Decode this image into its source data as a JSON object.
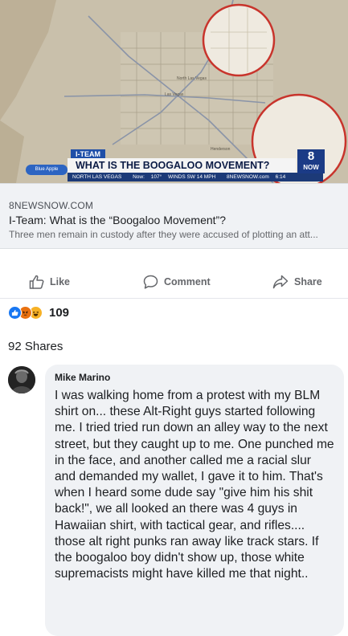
{
  "thumbnail": {
    "map_labels": [
      "North Las Vegas",
      "Las Vegas",
      "Henderson"
    ],
    "segment_tag": "I-TEAM",
    "headline": "WHAT IS THE BOOGALOO MOVEMENT?",
    "location": "NORTH LAS VEGAS",
    "weather_now": "Now:",
    "weather_temp": "107°",
    "wind": "WINDS SW 14 MPH",
    "site": "8NEWSNOW.com",
    "time": "6:14",
    "sponsor": "Blue Apple",
    "station_number": "8",
    "station_now": "NOW"
  },
  "preview": {
    "site": "8NEWSNOW.COM",
    "title": "I-Team: What is the “Boogaloo Movement”?",
    "description": "Three men remain in custody after they were accused of plotting an att..."
  },
  "actions": {
    "like": "Like",
    "comment": "Comment",
    "share": "Share"
  },
  "reactions": {
    "count": "109",
    "icons": [
      "like-icon",
      "angry-icon",
      "haha-icon"
    ]
  },
  "shares": "92 Shares",
  "comment": {
    "author": "Mike Marino",
    "text": "I was walking home from a protest with my BLM shirt on... these Alt-Right guys started following me. I tried tried run down an alley way to the next street, but they caught up to me. One punched me in the face, and another called me a racial slur and demanded my wallet, I gave it to him. That's when I heard some dude say \"give him his shit back!\", we all looked an there was 4 guys in Hawaiian shirt, with tactical gear, and rifles.... those alt right punks ran away like track stars. If the boogaloo boy didn't show up, those white supremacists might have killed me that night.."
  },
  "colors": {
    "brand_blue": "#1877f2",
    "chyron_navy": "#1c3a78",
    "map_beige": "#c9c0ab"
  }
}
